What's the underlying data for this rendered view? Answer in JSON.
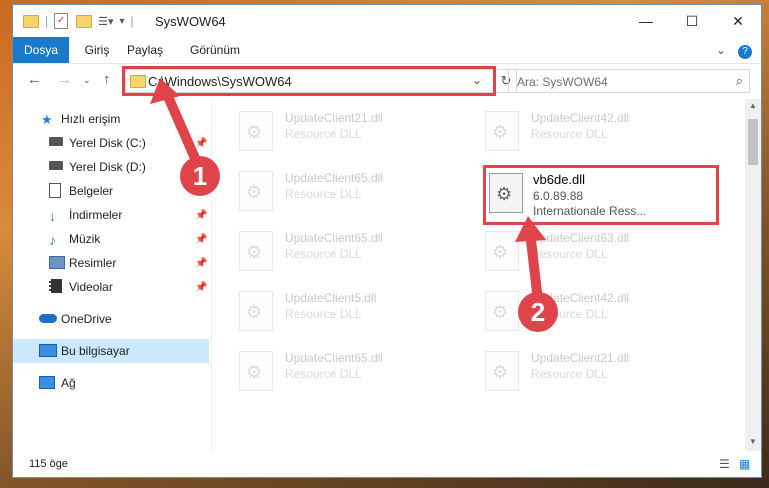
{
  "window": {
    "title": "SysWOW64",
    "controls": {
      "minimize": "—",
      "maximize": "☐",
      "close": "✕"
    }
  },
  "ribbon": {
    "tabs": [
      {
        "label": "Dosya"
      },
      {
        "label": "Giriş"
      },
      {
        "label": "Paylaş"
      },
      {
        "label": "Görünüm"
      }
    ],
    "help": "?"
  },
  "nav": {
    "address": "C:\\Windows\\SysWOW64",
    "search_placeholder": "Ara: SysWOW64"
  },
  "sidebar": {
    "items": [
      {
        "label": "Hızlı erişim",
        "icon": "star-icon"
      },
      {
        "label": "Yerel Disk (C:)",
        "icon": "drive-icon"
      },
      {
        "label": "Yerel Disk (D:)",
        "icon": "drive-icon"
      },
      {
        "label": "Belgeler",
        "icon": "document-icon"
      },
      {
        "label": "İndirmeler",
        "icon": "download-icon"
      },
      {
        "label": "Müzik",
        "icon": "music-icon"
      },
      {
        "label": "Resimler",
        "icon": "pictures-icon"
      },
      {
        "label": "Videolar",
        "icon": "video-icon"
      },
      {
        "label": "OneDrive",
        "icon": "cloud-icon"
      },
      {
        "label": "Bu bilgisayar",
        "icon": "computer-icon"
      },
      {
        "label": "Ağ",
        "icon": "network-icon"
      }
    ]
  },
  "files": [
    {
      "name": "UpdateClient21.dll",
      "type": "Resource DLL"
    },
    {
      "name": "UpdateClient42.dll",
      "type": "Resource DLL"
    },
    {
      "name": "UpdateClient65.dll",
      "type": "Resource DLL"
    },
    {
      "name": "vb6de.dll",
      "version": "6.0.89.88",
      "type": "Internationale Ress..."
    },
    {
      "name": "UpdateClient65.dll",
      "type": "Resource DLL"
    },
    {
      "name": "UpdateClient63.dll",
      "type": "Resource DLL"
    },
    {
      "name": "UpdateClient5.dll",
      "type": "Resource DLL"
    },
    {
      "name": "UpdateClient42.dll",
      "type": "Resource DLL"
    },
    {
      "name": "UpdateClient65.dll",
      "type": "Resource DLL"
    },
    {
      "name": "UpdateClient21.dll",
      "type": "Resource DLL"
    }
  ],
  "status": {
    "count": "115 öge"
  },
  "annotations": {
    "marker1": "1",
    "marker2": "2",
    "color": "#e0444b"
  }
}
